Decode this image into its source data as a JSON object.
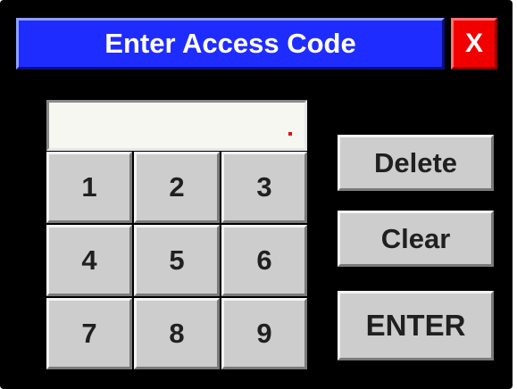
{
  "dialog": {
    "title": "Enter Access Code",
    "close_label": "X",
    "colors": {
      "background": "#000000",
      "title_bar": "#1f2cff",
      "close_button": "#f20000",
      "keys": "#cdcdcd",
      "display": "#f7f7f2"
    }
  },
  "code_input": {
    "value": ""
  },
  "keypad": {
    "keys": [
      "1",
      "2",
      "3",
      "4",
      "5",
      "6",
      "7",
      "8",
      "9"
    ]
  },
  "actions": {
    "delete_label": "Delete",
    "clear_label": "Clear",
    "enter_label": "ENTER"
  }
}
